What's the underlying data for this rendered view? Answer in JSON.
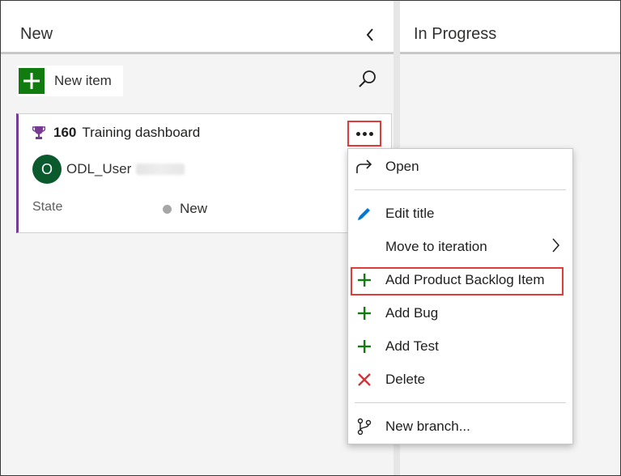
{
  "columns": {
    "new": {
      "title": "New"
    },
    "in_progress": {
      "title": "In Progress"
    }
  },
  "toolbar": {
    "new_item_label": "New item"
  },
  "card": {
    "id": "160",
    "title": "Training dashboard",
    "assignee_initial": "O",
    "assignee_name": "ODL_User",
    "state_label": "State",
    "state_value": "New",
    "accent_color": "#773b93"
  },
  "context_menu": {
    "items": [
      {
        "label": "Open",
        "icon": "redo-arrow-icon"
      },
      {
        "label": "Edit title",
        "icon": "pencil-icon"
      },
      {
        "label": "Move to iteration",
        "icon": "none"
      },
      {
        "label": "Add Product Backlog Item",
        "icon": "plus-icon"
      },
      {
        "label": "Add Bug",
        "icon": "plus-icon"
      },
      {
        "label": "Add Test",
        "icon": "plus-icon"
      },
      {
        "label": "Delete",
        "icon": "x-icon"
      },
      {
        "label": "New branch...",
        "icon": "branch-icon"
      }
    ]
  },
  "colors": {
    "plus_green": "#107c10",
    "delete_red": "#d13438",
    "edit_blue": "#0078d4",
    "highlight_red": "#e03c3c"
  }
}
